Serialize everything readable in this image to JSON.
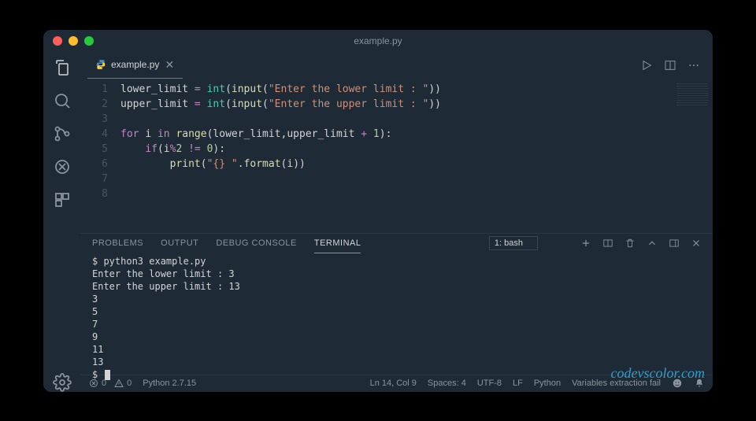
{
  "window": {
    "title": "example.py"
  },
  "tab": {
    "filename": "example.py"
  },
  "code": {
    "lines": [
      {
        "n": "1",
        "html": "<span class='c-var'>lower_limit</span> <span class='c-op'>=</span> <span class='c-fn'>int</span><span class='c-par'>(</span><span class='c-call'>input</span><span class='c-par'>(</span><span class='c-str'>\"Enter the lower limit : \"</span><span class='c-par'>))</span>"
      },
      {
        "n": "2",
        "html": "<span class='c-var'>upper_limit</span> <span class='c-op'>=</span> <span class='c-fn'>int</span><span class='c-par'>(</span><span class='c-call'>input</span><span class='c-par'>(</span><span class='c-str'>\"Enter the upper limit : \"</span><span class='c-par'>))</span>"
      },
      {
        "n": "3",
        "html": ""
      },
      {
        "n": "4",
        "html": "<span class='c-kw'>for</span> <span class='c-var'>i</span> <span class='c-kw'>in</span> <span class='c-call'>range</span><span class='c-par'>(</span><span class='c-var'>lower_limit</span><span class='c-par'>,</span><span class='c-var'>upper_limit</span> <span class='c-op'>+</span> <span class='c-num'>1</span><span class='c-par'>):</span>"
      },
      {
        "n": "5",
        "html": "    <span class='c-kw'>if</span><span class='c-par'>(</span><span class='c-var'>i</span><span class='c-op'>%</span><span class='c-num'>2</span> <span class='c-op'>!=</span> <span class='c-num'>0</span><span class='c-par'>):</span>"
      },
      {
        "n": "6",
        "html": "        <span class='c-call'>print</span><span class='c-par'>(</span><span class='c-str'>\"{} \"</span><span class='c-par'>.</span><span class='c-call'>format</span><span class='c-par'>(</span><span class='c-var'>i</span><span class='c-par'>))</span>"
      },
      {
        "n": "7",
        "html": ""
      },
      {
        "n": "8",
        "html": ""
      }
    ]
  },
  "panel": {
    "tabs": {
      "problems": "PROBLEMS",
      "output": "OUTPUT",
      "debug": "DEBUG CONSOLE",
      "terminal": "TERMINAL"
    },
    "term_selector": "1: bash"
  },
  "terminal": {
    "lines": [
      "$ python3 example.py",
      "Enter the lower limit : 3",
      "Enter the upper limit : 13",
      "3",
      "5",
      "7",
      "9",
      "11",
      "13",
      "$ "
    ]
  },
  "watermark": "codevscolor.com",
  "status": {
    "errors": "0",
    "warnings": "0",
    "interpreter": "Python 2.7.15",
    "cursor": "Ln 14, Col 9",
    "spaces": "Spaces: 4",
    "encoding": "UTF-8",
    "eol": "LF",
    "lang": "Python",
    "extra": "Variables extraction fail"
  }
}
